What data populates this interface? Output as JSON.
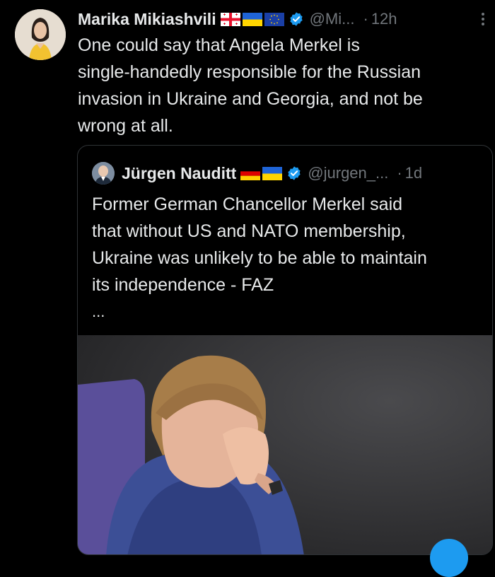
{
  "post": {
    "author_name": "Marika Mikiashvili",
    "handle": "@Mi...",
    "separator": "·",
    "time": "12h",
    "text": "One could say that Angela Merkel is\nsingle-handedly responsible for the Russian\ninvasion in Ukraine and Georgia, and not be\nwrong at all.",
    "flags": [
      "georgia-flag-icon",
      "ukraine-flag-icon",
      "eu-flag-icon"
    ]
  },
  "quoted_post": {
    "author_name": "Jürgen Nauditt",
    "handle": "@jurgen_...",
    "separator": "·",
    "time": "1d",
    "text": "Former German Chancellor Merkel said\nthat without US and NATO membership,\nUkraine was unlikely to be able to maintain\nits independence - FAZ",
    "ellipsis": "...",
    "flags": [
      "germany-flag-icon",
      "ukraine-flag-icon"
    ]
  },
  "colors": {
    "background": "#000000",
    "text_primary": "#e7e9ea",
    "text_secondary": "#71767b",
    "verified_blue": "#1d9bf0",
    "border": "#2f3336"
  }
}
